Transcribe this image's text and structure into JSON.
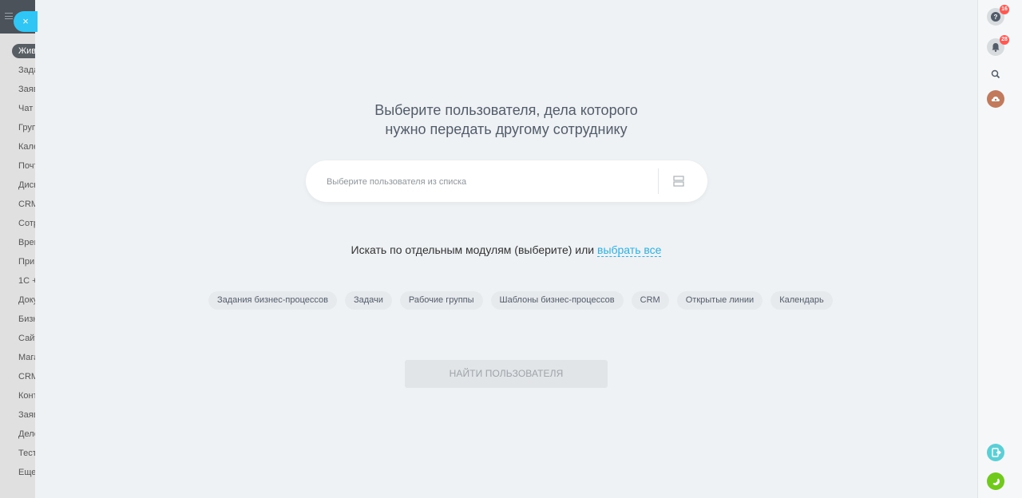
{
  "sidebar": {
    "items": [
      {
        "label": "Жив",
        "active": true
      },
      {
        "label": "Зада"
      },
      {
        "label": "Заяв"
      },
      {
        "label": "Чат"
      },
      {
        "label": "Груп"
      },
      {
        "label": "Кале"
      },
      {
        "label": "Почт"
      },
      {
        "label": "Диск"
      },
      {
        "label": "CRM"
      },
      {
        "label": "Сотр"
      },
      {
        "label": "Врем"
      },
      {
        "label": "При"
      },
      {
        "label": "1С +"
      },
      {
        "label": "Доку"
      },
      {
        "label": "Бизн"
      },
      {
        "label": "Сайт"
      },
      {
        "label": "Мага"
      },
      {
        "label": "CRM"
      },
      {
        "label": "Конт"
      },
      {
        "label": "Заяв"
      },
      {
        "label": "Дело"
      },
      {
        "label": "Тест"
      },
      {
        "label": "Еще"
      }
    ]
  },
  "close_button": {
    "label": "×"
  },
  "main": {
    "title_line1": "Выберите пользователя, дела которого",
    "title_line2": "нужно передать другому сотруднику",
    "user_select_placeholder": "Выберите пользователя из списка",
    "modules_prefix": "Искать по отдельным модулям (выберите) или",
    "select_all_label": "выбрать все",
    "modules": [
      "Задания бизнес-процессов",
      "Задачи",
      "Рабочие группы",
      "Шаблоны бизнес-процессов",
      "CRM",
      "Открытые линии",
      "Календарь"
    ],
    "find_button_label": "НАЙТИ ПОЛЬЗОВАТЕЛЯ"
  },
  "right_panel": {
    "help_badge": "16",
    "notifications_badge": "28"
  },
  "colors": {
    "accent": "#2fc6f6",
    "link": "#2fb0e6",
    "badge": "#ff5752",
    "phone": "#71c91e"
  }
}
